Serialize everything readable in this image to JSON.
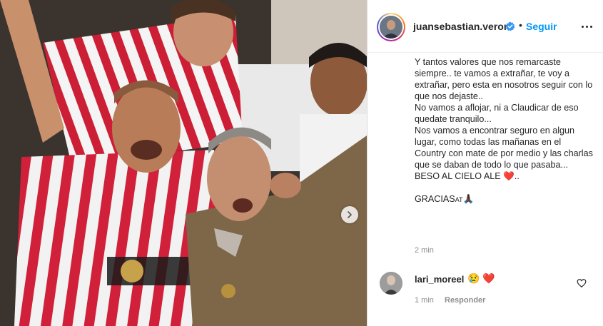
{
  "post": {
    "image_description": "",
    "carousel_next_icon": "chevron-right-icon"
  },
  "header": {
    "username": "juansebastian.veron",
    "verified_icon": "verified-badge-icon",
    "separator": "•",
    "follow_label": "Seguir",
    "more_icon": "more-options-icon"
  },
  "caption": {
    "lines": "Y tantos valores que nos remarcaste siempre.. te vamos a extrañar, te voy a extrañar, pero esta en nosotros seguir con lo que nos dejaste..\nNo vamos a aflojar, ni a Claudicar de eso quedate tranquilo...\nNos vamos a encontrar seguro en algun lugar, como todas las mañanas en el Country con mate de por medio y las charlas que se daban de todo lo que pasaba...\nBESO AL CIELO ALE ",
    "heart": "❤️",
    "after_heart": "..",
    "thanks": "GRACIAS",
    "thanks_suffix": "AT",
    "pray": "🙏🏿",
    "time": "2 min"
  },
  "comment": {
    "username": "lari_moreel",
    "text_emoji_1": "😢",
    "text_emoji_2": "❤️",
    "time": "1 min",
    "reply_label": "Responder",
    "like_icon": "heart-outline-icon"
  },
  "colors": {
    "accent": "#0095f6",
    "heart": "#ed1c3a",
    "muted": "#8e8e8e"
  }
}
